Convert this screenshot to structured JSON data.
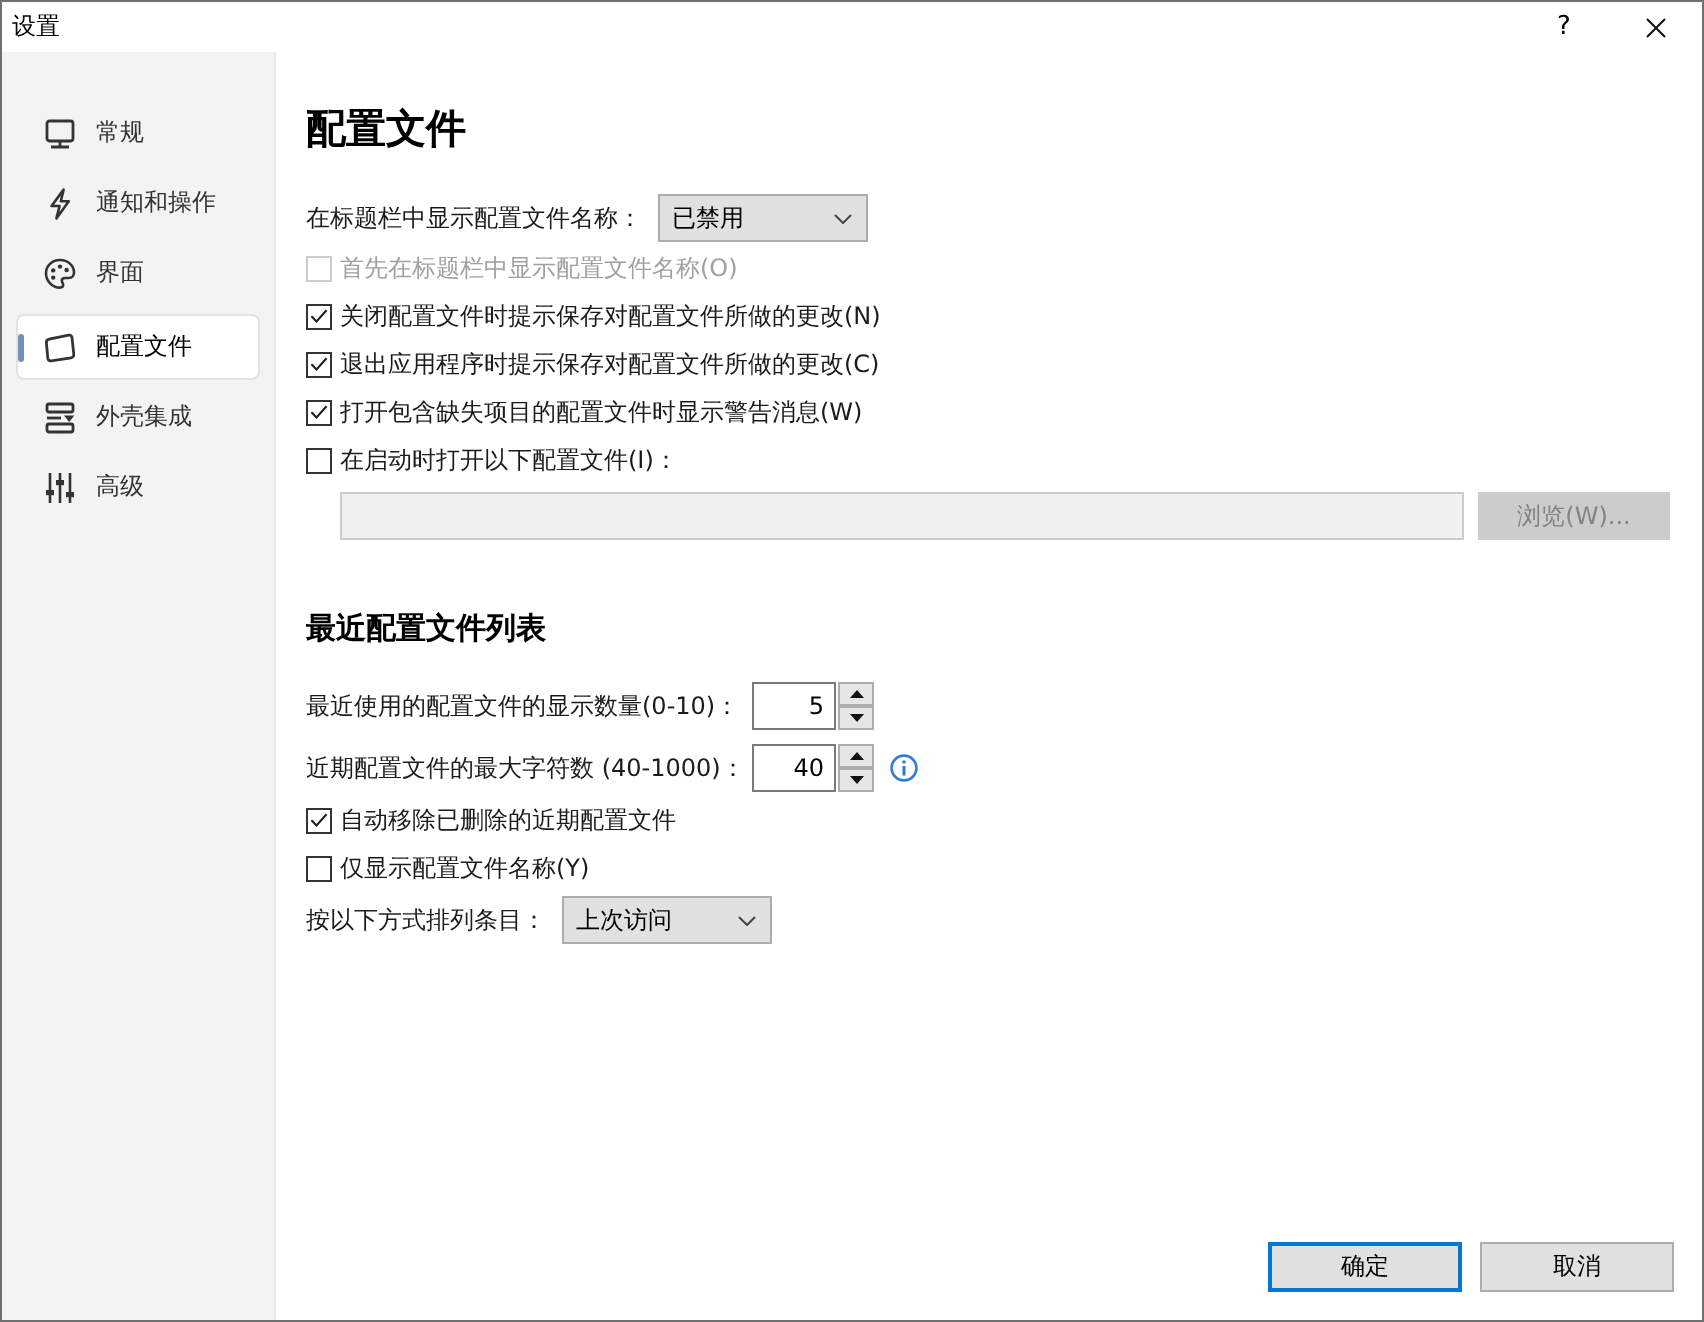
{
  "window": {
    "title": "设置",
    "help": "?"
  },
  "sidebar": {
    "items": [
      {
        "label": "常规",
        "selected": false
      },
      {
        "label": "通知和操作",
        "selected": false
      },
      {
        "label": "界面",
        "selected": false
      },
      {
        "label": "配置文件",
        "selected": true
      },
      {
        "label": "外壳集成",
        "selected": false
      },
      {
        "label": "高级",
        "selected": false
      }
    ]
  },
  "profiles": {
    "title": "配置文件",
    "title_bar_name": {
      "label": "在标题栏中显示配置文件名称：",
      "value": "已禁用"
    },
    "checkboxes": [
      {
        "label": "首先在标题栏中显示配置文件名称(O)",
        "checked": false,
        "disabled": true
      },
      {
        "label": "关闭配置文件时提示保存对配置文件所做的更改(N)",
        "checked": true,
        "disabled": false
      },
      {
        "label": "退出应用程序时提示保存对配置文件所做的更改(C)",
        "checked": true,
        "disabled": false
      },
      {
        "label": "打开包含缺失项目的配置文件时显示警告消息(W)",
        "checked": true,
        "disabled": false
      },
      {
        "label": "在启动时打开以下配置文件(I)：",
        "checked": false,
        "disabled": false
      }
    ],
    "startup_file": {
      "disabled": true
    },
    "browse_button": {
      "label": "浏览(W)...",
      "disabled": true
    }
  },
  "recent": {
    "title": "最近配置文件列表",
    "spinners": [
      {
        "label": "最近使用的配置文件的显示数量(0-10)：",
        "value": "5",
        "info": false
      },
      {
        "label": "近期配置文件的最大字符数 (40-1000)：",
        "value": "40",
        "info": true
      }
    ],
    "checkboxes": [
      {
        "label": "自动移除已删除的近期配置文件",
        "checked": true,
        "disabled": false
      },
      {
        "label": "仅显示配置文件名称(Y)",
        "checked": false,
        "disabled": false
      }
    ],
    "sort": {
      "label": "按以下方式排列条目：",
      "value": "上次访问"
    }
  },
  "buttons": [
    {
      "label": "确定",
      "default": true
    },
    {
      "label": "取消",
      "default": false
    }
  ]
}
